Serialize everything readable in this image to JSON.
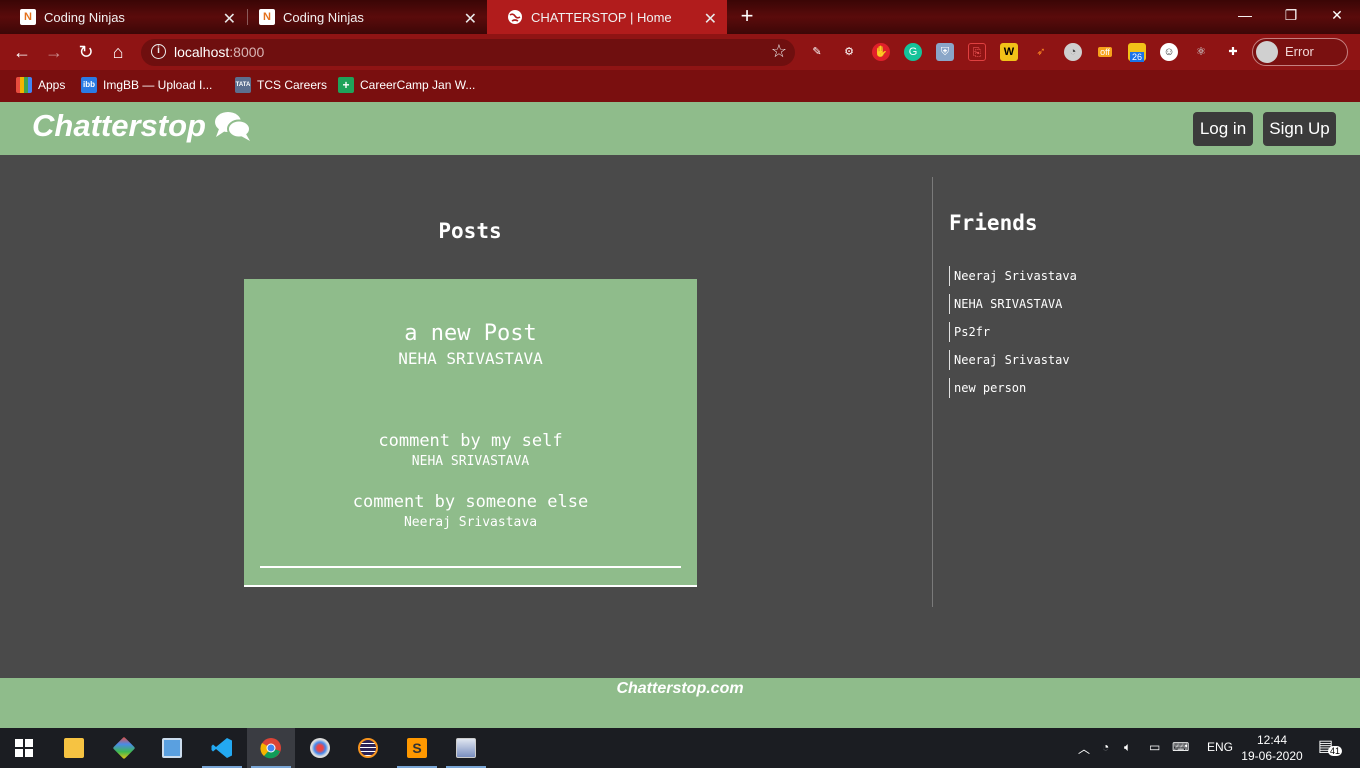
{
  "browser": {
    "tabs": [
      {
        "title": "Coding Ninjas",
        "active": false
      },
      {
        "title": "Coding Ninjas",
        "active": false
      },
      {
        "title": "CHATTERSTOP | Home",
        "active": true
      }
    ],
    "address": {
      "host": "localhost",
      "port": ":8000"
    },
    "profile_label": "Error",
    "bookmarks": [
      {
        "label": "Apps",
        "icon": "apps-grid-icon"
      },
      {
        "label": "ImgBB — Upload I...",
        "icon": "imgbb-icon",
        "icon_text": "ibb"
      },
      {
        "label": "TCS Careers",
        "icon": "tata-icon",
        "icon_text": "TATA"
      },
      {
        "label": "CareerCamp Jan W...",
        "icon": "careercamp-icon"
      }
    ],
    "extension_badges": {
      "offer": "off",
      "count": "26"
    }
  },
  "site": {
    "brand": "Chatterstop",
    "nav": {
      "login": "Log in",
      "signup": "Sign Up"
    },
    "posts_title": "Posts",
    "post": {
      "content": "a new Post",
      "author": "NEHA SRIVASTAVA",
      "comments": [
        {
          "text": "comment by my self",
          "author": "NEHA SRIVASTAVA"
        },
        {
          "text": "comment by someone else",
          "author": "Neeraj Srivastava"
        }
      ]
    },
    "friends_title": "Friends",
    "friends": [
      "Neeraj Srivastava",
      "NEHA SRIVASTAVA",
      "Ps2fr",
      "Neeraj Srivastav",
      "new person"
    ],
    "footer": "Chatterstop.com"
  },
  "taskbar": {
    "lang": "ENG",
    "time": "12:44",
    "date": "19-06-2020",
    "notifications": "41"
  },
  "colors": {
    "accent_green": "#8fbc8b",
    "page_bg": "#4a4a4a",
    "chrome_red": "#8f1414"
  }
}
